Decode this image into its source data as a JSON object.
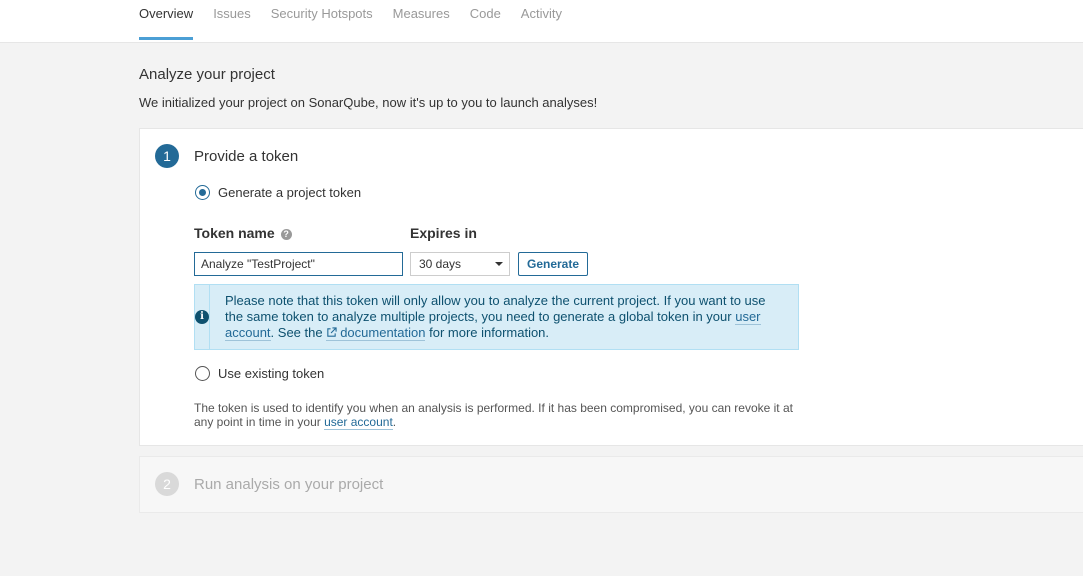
{
  "tabs": [
    {
      "label": "Overview",
      "active": true
    },
    {
      "label": "Issues"
    },
    {
      "label": "Security Hotspots"
    },
    {
      "label": "Measures"
    },
    {
      "label": "Code"
    },
    {
      "label": "Activity"
    }
  ],
  "page": {
    "title": "Analyze your project",
    "description": "We initialized your project on SonarQube, now it's up to you to launch analyses!"
  },
  "step1": {
    "number": "1",
    "title": "Provide a token",
    "generate_option": "Generate a project token",
    "token_name_label": "Token name",
    "token_name_value": "Analyze \"TestProject\"",
    "expires_label": "Expires in",
    "expires_value": "30 days",
    "generate_button": "Generate",
    "alert": {
      "text1": "Please note that this token will only allow you to analyze the current project. If you want to use the same token to analyze multiple projects, you need to generate a global token in your ",
      "link1": "user account",
      "text2": ". See the ",
      "link2": "documentation",
      "text3": " for more information."
    },
    "existing_option": "Use existing token",
    "footnote_text": "The token is used to identify you when an analysis is performed. If it has been compromised, you can revoke it at any point in time in your ",
    "footnote_link": "user account",
    "footnote_end": "."
  },
  "step2": {
    "number": "2",
    "title": "Run analysis on your project"
  },
  "colors": {
    "accent": "#236a97",
    "tab_underline": "#4b9fd5",
    "alert_bg": "#d8edf7"
  }
}
